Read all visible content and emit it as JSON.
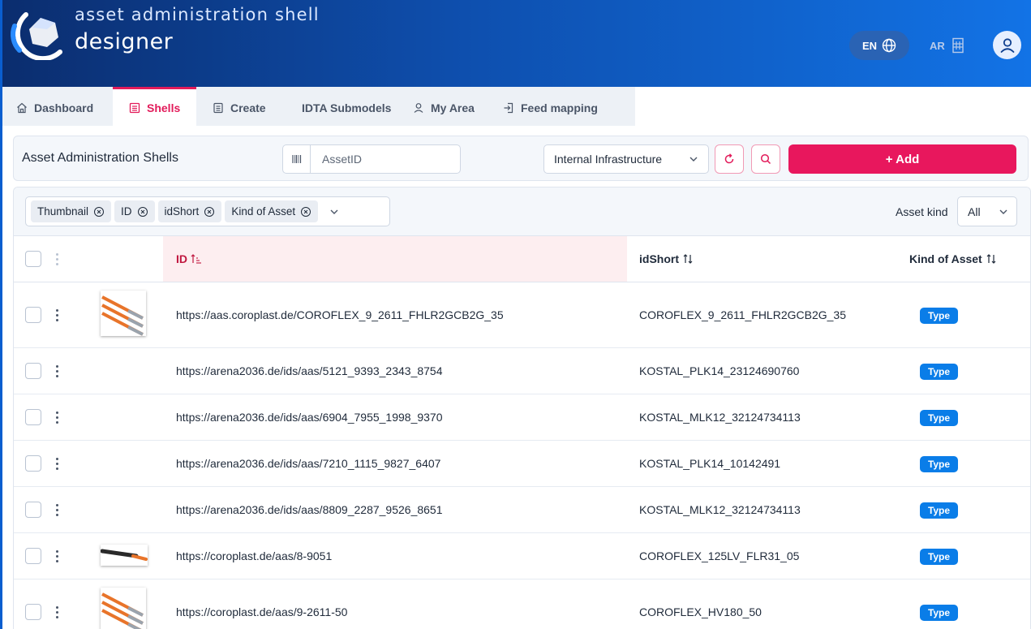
{
  "header": {
    "brand_line1": "asset administration shell",
    "brand_line2": "designer",
    "lang_label": "EN",
    "ar_label": "AR"
  },
  "nav": {
    "items": [
      {
        "label": "Dashboard",
        "icon": "home-icon"
      },
      {
        "label": "Shells",
        "icon": "list-icon",
        "active": true
      },
      {
        "label": "Create",
        "icon": "document-icon"
      },
      {
        "label": "IDTA Submodels",
        "icon": ""
      },
      {
        "label": "My Area",
        "icon": "user-icon"
      },
      {
        "label": "Feed mapping",
        "icon": "import-icon"
      }
    ]
  },
  "toolbar": {
    "title": "Asset Administration Shells",
    "search_placeholder": "AssetID",
    "repository": "Internal Infrastructure",
    "add_label": "+ Add"
  },
  "filters": {
    "chips": [
      "Thumbnail",
      "ID",
      "idShort",
      "Kind of Asset"
    ],
    "asset_kind_label": "Asset kind",
    "asset_kind_value": "All"
  },
  "table": {
    "columns": {
      "id": "ID",
      "idshort": "idShort",
      "kind": "Kind of Asset"
    },
    "rows": [
      {
        "id": "https://aas.coroplast.de/COROFLEX_9_2611_FHLR2GCB2G_35",
        "idShort": "COROFLEX_9_2611_FHLR2GCB2G_35",
        "kind": "Type",
        "thumbnail": "cable-bundle"
      },
      {
        "id": "https://arena2036.de/ids/aas/5121_9393_2343_8754",
        "idShort": "KOSTAL_PLK14_23124690760",
        "kind": "Type",
        "thumbnail": ""
      },
      {
        "id": "https://arena2036.de/ids/aas/6904_7955_1998_9370",
        "idShort": "KOSTAL_MLK12_32124734113",
        "kind": "Type",
        "thumbnail": ""
      },
      {
        "id": "https://arena2036.de/ids/aas/7210_1115_9827_6407",
        "idShort": "KOSTAL_PLK14_10142491",
        "kind": "Type",
        "thumbnail": ""
      },
      {
        "id": "https://arena2036.de/ids/aas/8809_2287_9526_8651",
        "idShort": "KOSTAL_MLK12_32124734113",
        "kind": "Type",
        "thumbnail": ""
      },
      {
        "id": "https://coroplast.de/aas/8-9051",
        "idShort": "COROFLEX_125LV_FLR31_05",
        "kind": "Type",
        "thumbnail": "single-cable"
      },
      {
        "id": "https://coroplast.de/aas/9-2611-50",
        "idShort": "COROFLEX_HV180_50",
        "kind": "Type",
        "thumbnail": "cable-bundle"
      }
    ]
  },
  "colors": {
    "accent": "#e8175d",
    "badge": "#0a7de8",
    "header_dark": "#0b2d6e",
    "header_light": "#1273e6"
  }
}
